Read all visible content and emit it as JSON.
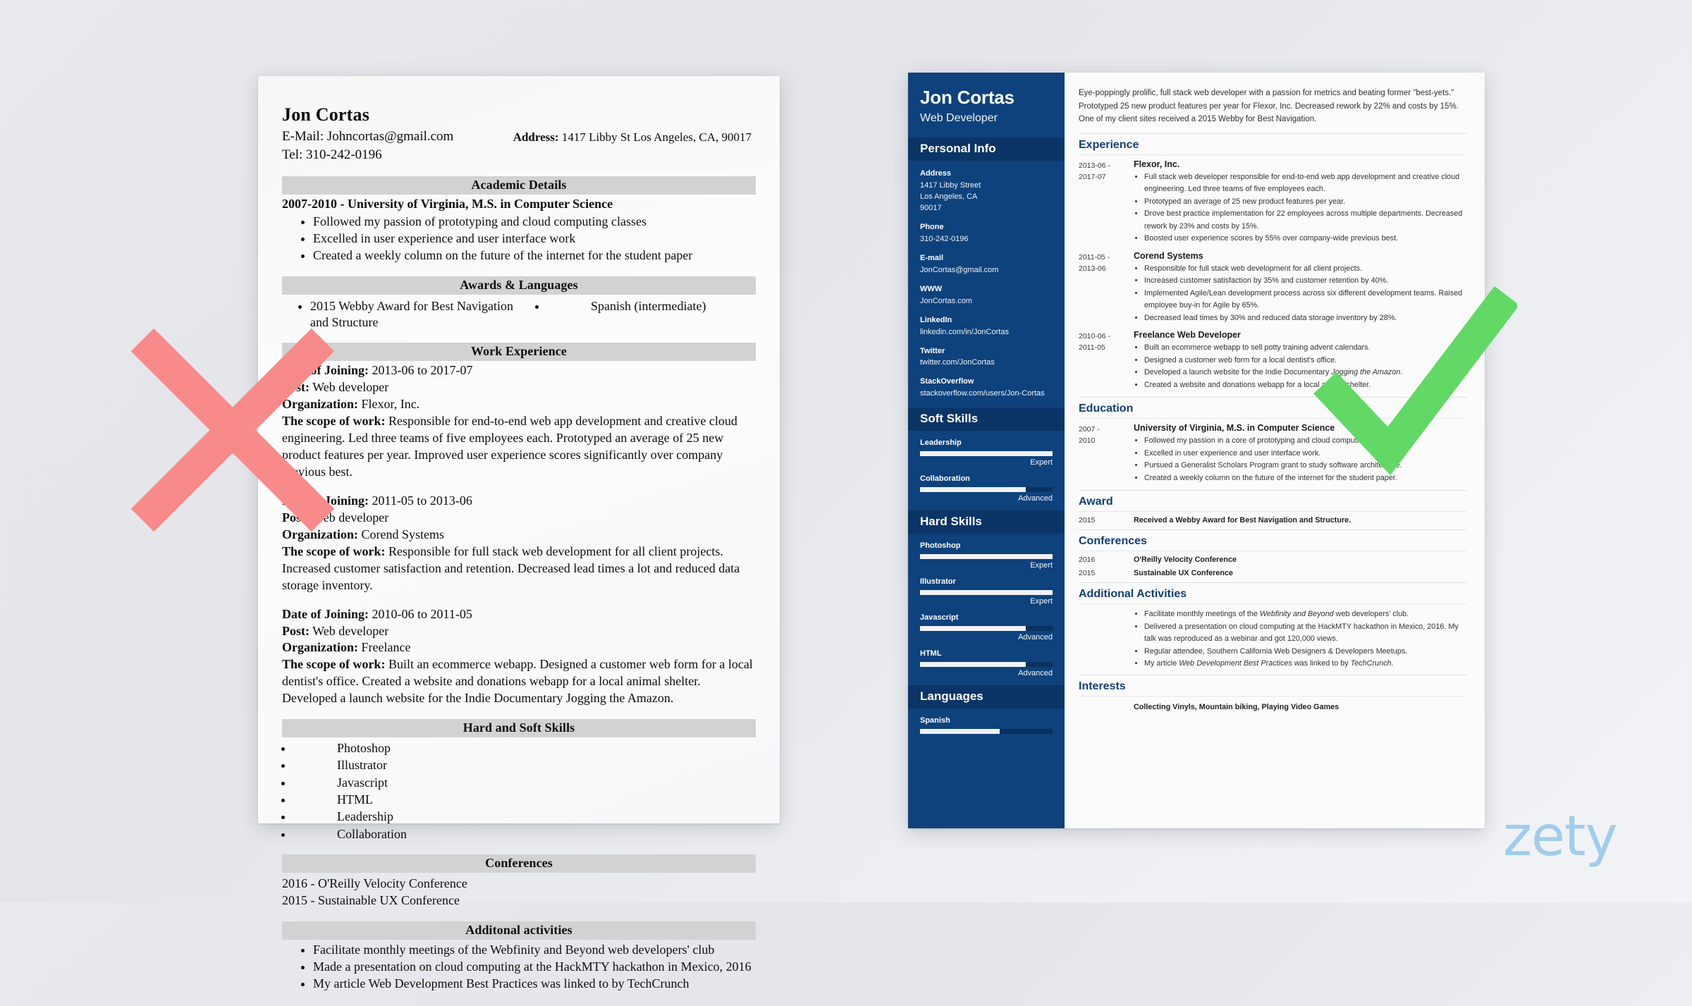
{
  "bad_resume": {
    "name": "Jon Cortas",
    "email_line": "E-Mail: Johncortas@gmail.com",
    "phone_line": "Tel: 310-242-0196",
    "address_label": "Address:",
    "address_value": "1417 Libby St Los Angeles, CA, 90017",
    "sections": {
      "academic": {
        "heading": "Academic Details",
        "degree_line": "2007-2010 - University of Virginia, M.S. in Computer Science",
        "bullets": [
          "Followed my passion of prototyping and cloud computing classes",
          "Excelled in user experience and user interface work",
          "Created a weekly column on the future of the internet for the student paper"
        ]
      },
      "awards": {
        "heading": "Awards & Languages",
        "awards": [
          "2015 Webby Award for Best Navigation and Structure"
        ],
        "languages": [
          "Spanish (intermediate)"
        ]
      },
      "work": {
        "heading": "Work Experience",
        "label_date": "Date of Joining:",
        "label_post": "Post:",
        "label_org": "Organization:",
        "label_scope": "The scope of work:",
        "jobs": [
          {
            "date": "2013-06 to 2017-07",
            "post": "Web developer",
            "org": "Flexor, Inc.",
            "scope": "Responsible for end-to-end web app development and creative cloud engineering. Led three teams of five employees each. Prototyped an average of 25 new product features per year. Improved user experience scores significantly over company previous best."
          },
          {
            "date": "2011-05 to 2013-06",
            "post": "Web developer",
            "org": "Corend Systems",
            "scope": "Responsible for full stack web development for all client projects. Increased customer satisfaction and retention. Decreased lead times a lot and reduced data storage inventory."
          },
          {
            "date": "2010-06 to 2011-05",
            "post": "Web developer",
            "org": "Freelance",
            "scope": "Built an ecommerce webapp. Designed a customer web form for a local dentist's office. Created a website and donations webapp for a local animal shelter. Developed a launch website for the Indie Documentary Jogging the Amazon."
          }
        ]
      },
      "skills": {
        "heading": "Hard and Soft Skills",
        "items": [
          "Photoshop",
          "Illustrator",
          "Javascript",
          "HTML",
          "Leadership",
          "Collaboration"
        ]
      },
      "conferences": {
        "heading": "Conferences",
        "items": [
          "2016 - O'Reilly Velocity Conference",
          "2015 - Sustainable UX Conference"
        ]
      },
      "additional": {
        "heading": "Additonal activities",
        "items": [
          "Facilitate monthly meetings of the Webfinity and Beyond web developers' club",
          "Made a presentation on cloud computing at the HackMTY hackathon in Mexico, 2016",
          "My article Web Development Best Practices was linked to by TechCrunch"
        ]
      }
    }
  },
  "good_resume": {
    "sidebar": {
      "name": "Jon Cortas",
      "job_title": "Web Developer",
      "personal_info_heading": "Personal Info",
      "fields": [
        {
          "label": "Address",
          "value": "1417 Libby Street\nLos Angeles, CA\n90017"
        },
        {
          "label": "Phone",
          "value": "310-242-0196"
        },
        {
          "label": "E-mail",
          "value": "JonCortas@gmail.com"
        },
        {
          "label": "WWW",
          "value": "JonCortas.com"
        },
        {
          "label": "LinkedIn",
          "value": "linkedin.com/in/JonCortas"
        },
        {
          "label": "Twitter",
          "value": "twitter.com/JonCortas"
        },
        {
          "label": "StackOverflow",
          "value": "stackoverflow.com/users/Jon-Cortas"
        }
      ],
      "soft_skills_heading": "Soft Skills",
      "soft_skills": [
        {
          "name": "Leadership",
          "level": "Expert",
          "percent": 100
        },
        {
          "name": "Collaboration",
          "level": "Advanced",
          "percent": 80
        }
      ],
      "hard_skills_heading": "Hard Skills",
      "hard_skills": [
        {
          "name": "Photoshop",
          "level": "Expert",
          "percent": 100
        },
        {
          "name": "Illustrator",
          "level": "Expert",
          "percent": 100
        },
        {
          "name": "Javascript",
          "level": "Advanced",
          "percent": 80
        },
        {
          "name": "HTML",
          "level": "Advanced",
          "percent": 80
        }
      ],
      "languages_heading": "Languages",
      "languages": [
        {
          "name": "Spanish",
          "level": "",
          "percent": 60
        }
      ]
    },
    "main": {
      "summary": "Eye-poppingly prolific, full stack web developer with a passion for metrics and beating former \"best-yets.\" Prototyped 25 new product features per year for Flexor, Inc. Decreased rework by 22% and costs by 15%. One of my client sites received a 2015 Webby for Best Navigation.",
      "experience_heading": "Experience",
      "experience": [
        {
          "date": "2013-06 -\n2017-07",
          "title": "Flexor, Inc.",
          "bullets": [
            "Full stack web developer responsible for end-to-end web app development and creative cloud engineering. Led three teams of five employees each.",
            "Prototyped an average of 25 new product features per year.",
            "Drove best practice implementation for 22 employees across multiple departments. Decreased rework by 23% and costs by 15%.",
            "Boosted user experience scores by 55% over company-wide previous best."
          ]
        },
        {
          "date": "2011-05 -\n2013-06",
          "title": "Corend Systems",
          "bullets": [
            "Responsible for full stack web development for all client projects.",
            "Increased customer satisfaction by 35% and customer retention by 40%.",
            "Implemented Agile/Lean development process across six different development teams. Raised employee buy-in for Agile by 65%.",
            "Decreased lead times by 30% and reduced data storage inventory by 28%."
          ]
        },
        {
          "date": "2010-06 -\n2011-05",
          "title": "Freelance Web Developer",
          "bullets": [
            "Built an ecommerce webapp to sell potty training advent calendars.",
            "Designed a customer web form for a local dentist's office.",
            "Developed a launch website for the Indie Documentary <em>Jogging the Amazon</em>.",
            "Created a website and donations webapp for a local animal shelter."
          ]
        }
      ],
      "education_heading": "Education",
      "education": [
        {
          "date": "2007 -\n2010",
          "title": "University of Virginia, M.S. in Computer Science",
          "bullets": [
            "Followed my passion in a core of prototyping and cloud computing classes.",
            "Excelled in user experience and user interface work.",
            "Pursued a Generalist Scholars Program grant to study software architecture.",
            "Created a weekly column on the future of the internet for the student paper."
          ]
        }
      ],
      "award_heading": "Award",
      "awards": [
        {
          "date": "2015",
          "text": "Received a Webby Award for Best Navigation and Structure."
        }
      ],
      "conferences_heading": "Conferences",
      "conferences": [
        {
          "date": "2016",
          "text": "O'Reilly Velocity Conference"
        },
        {
          "date": "2015",
          "text": "Sustainable UX Conference"
        }
      ],
      "additional_heading": "Additional Activities",
      "additional": [
        "Facilitate monthly meetings of the <em>Webfinity and Beyond</em> web developers' club.",
        "Delivered a presentation on cloud computing at the HackMTY hackathon in Mexico, 2016. My talk was reproduced as a webinar and got 120,000 views.",
        "Regular attendee, Southern California Web Designers &amp; Developers Meetups.",
        "My article <em>Web Development Best Practices</em> was linked to by <em>TechCrunch</em>."
      ],
      "interests_heading": "Interests",
      "interests_text": "Collecting Vinyls, Mountain biking, Playing Video Games"
    }
  },
  "annotations": {
    "reject_mark": "red-x-mark",
    "accept_mark": "green-check-mark",
    "reject_color": "#f98a8a",
    "accept_color": "#61d964"
  },
  "branding": {
    "logo_text": "zety",
    "logo_color": "#9fcdeb"
  }
}
